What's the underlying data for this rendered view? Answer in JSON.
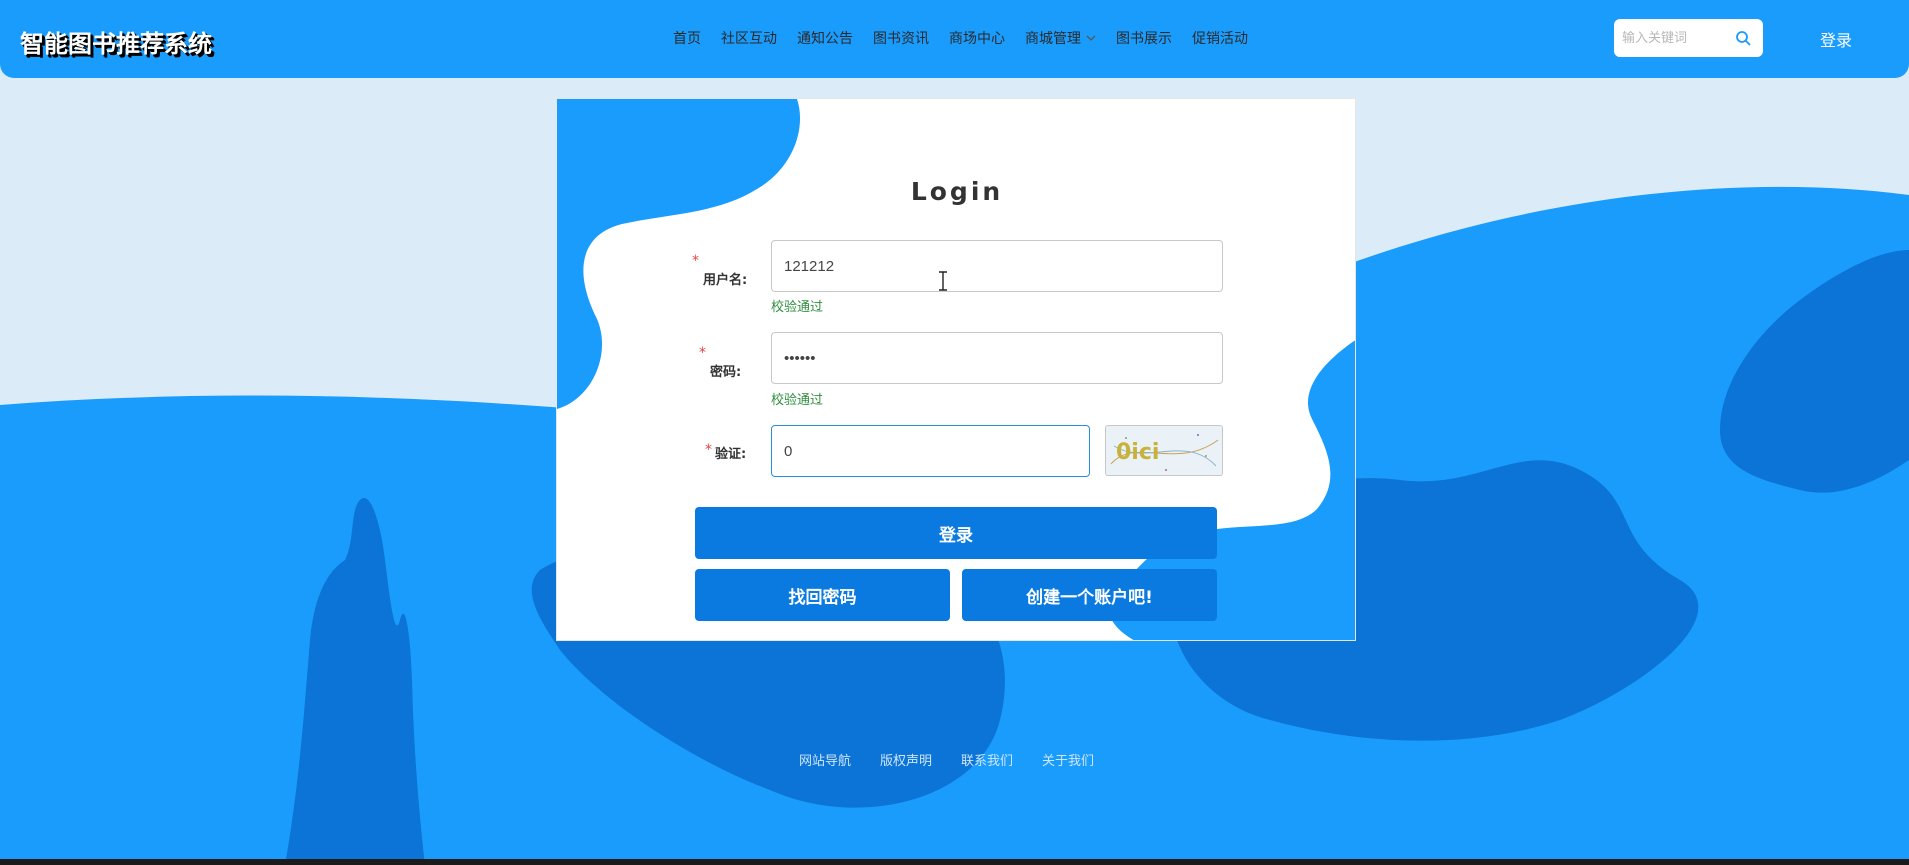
{
  "header": {
    "site_title": "智能图书推荐系统",
    "nav": [
      {
        "label": "首页",
        "has_dropdown": false
      },
      {
        "label": "社区互动",
        "has_dropdown": false
      },
      {
        "label": "通知公告",
        "has_dropdown": false
      },
      {
        "label": "图书资讯",
        "has_dropdown": false
      },
      {
        "label": "商场中心",
        "has_dropdown": false
      },
      {
        "label": "商城管理",
        "has_dropdown": true
      },
      {
        "label": "图书展示",
        "has_dropdown": false
      },
      {
        "label": "促销活动",
        "has_dropdown": false
      }
    ],
    "search": {
      "placeholder": "输入关键词",
      "value": ""
    },
    "login_label": "登录"
  },
  "login": {
    "title": "Login",
    "username": {
      "label": "用户名:",
      "value": "121212",
      "status": "校验通过"
    },
    "password": {
      "label": "密码:",
      "value": "••••••",
      "status": "校验通过"
    },
    "captcha": {
      "label": "验证:",
      "value": "0",
      "image_text": "0ici"
    },
    "required_mark": "*",
    "login_button": "登录",
    "forgot_button": "找回密码",
    "register_button": "创建一个账户吧!"
  },
  "footer": {
    "links": [
      "网站导航",
      "版权声明",
      "联系我们",
      "关于我们"
    ]
  },
  "colors": {
    "primary": "#1a9cfc",
    "button": "#0b7ae0",
    "page_bg": "#dcebf8",
    "dark_blob": "#0b74d6",
    "valid_text": "#2f8f3f",
    "required": "#e34444"
  }
}
